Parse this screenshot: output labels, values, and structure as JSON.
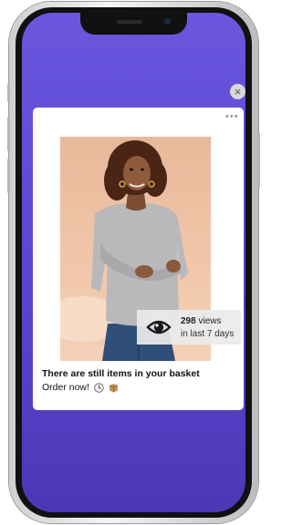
{
  "popup": {
    "close_icon": "close-icon",
    "more_icon": "more-horizontal-icon",
    "views_count": "298",
    "views_label": "views",
    "views_period": "in last 7 days",
    "headline": "There are still items in your basket",
    "subline": "Order now!",
    "subline_icons": [
      "clock-icon",
      "package-icon"
    ]
  },
  "colors": {
    "background_top": "#6a57de",
    "background_bottom": "#4e37b6",
    "card": "#ffffff",
    "badge": "#ebebeb"
  }
}
